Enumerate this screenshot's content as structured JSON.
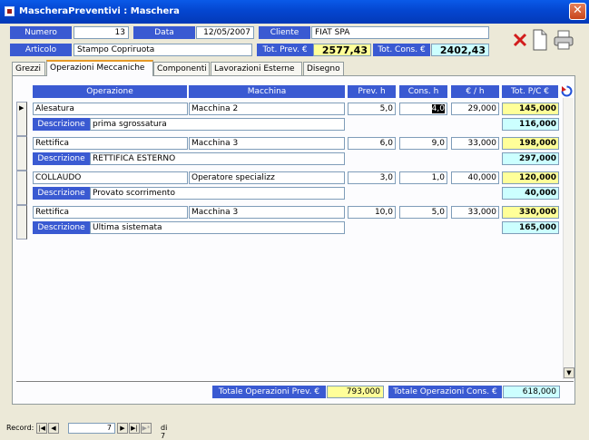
{
  "window": {
    "title": "MascheraPreventivi : Maschera",
    "close_label": "✕"
  },
  "header": {
    "numero_label": "Numero",
    "numero": "13",
    "data_label": "Data",
    "data": "12/05/2007",
    "cliente_label": "Cliente",
    "cliente": "FIAT   SPA",
    "articolo_label": "Articolo",
    "articolo": "Stampo Copriruota",
    "tot_prev_label": "Tot. Prev. €",
    "tot_prev": "2577,43",
    "tot_cons_label": "Tot. Cons. €",
    "tot_cons": "2402,43"
  },
  "toolbar": {
    "delete_icon": "delete-x-icon",
    "new_icon": "new-document-icon",
    "print_icon": "printer-icon"
  },
  "tabs": [
    "Grezzi",
    "Operazioni Meccaniche",
    "Componenti",
    "Lavorazioni Esterne",
    "Disegno"
  ],
  "grid": {
    "headers": {
      "operazione": "Operazione",
      "macchina": "Macchina",
      "prev_h": "Prev. h",
      "cons_h": "Cons. h",
      "eur_h": "€ / h",
      "tot": "Tot. P/C €"
    },
    "desc_label": "Descrizione",
    "rows": [
      {
        "operazione": "Alesatura",
        "macchina": "Macchina 2",
        "prev_h": "5,0",
        "cons_h": "4,0",
        "eur_h": "29,000",
        "tot_prev": "145,000",
        "descrizione": "prima sgrossatura",
        "tot_cons": "116,000"
      },
      {
        "operazione": "Rettifica",
        "macchina": "Macchina 3",
        "prev_h": "6,0",
        "cons_h": "9,0",
        "eur_h": "33,000",
        "tot_prev": "198,000",
        "descrizione": "RETTIFICA ESTERNO",
        "tot_cons": "297,000"
      },
      {
        "operazione": "COLLAUDO",
        "macchina": "Operatore specializz",
        "prev_h": "3,0",
        "cons_h": "1,0",
        "eur_h": "40,000",
        "tot_prev": "120,000",
        "descrizione": "Provato scorrimento",
        "tot_cons": "40,000"
      },
      {
        "operazione": "Rettifica",
        "macchina": "Macchina 3",
        "prev_h": "10,0",
        "cons_h": "5,0",
        "eur_h": "33,000",
        "tot_prev": "330,000",
        "descrizione": "Ultima sistemata",
        "tot_cons": "165,000"
      }
    ]
  },
  "footer": {
    "tot_op_prev_label": "Totale Operazioni Prev. €",
    "tot_op_prev": "793,000",
    "tot_op_cons_label": "Totale Operazioni Cons. €",
    "tot_op_cons": "618,000"
  },
  "navigation": {
    "record_label": "Record:",
    "current": "7",
    "of_label": "di 7"
  },
  "colors": {
    "label_blue": "#3a5ad2",
    "prev_yellow": "#ffff99",
    "cons_cyan": "#ccffff"
  }
}
